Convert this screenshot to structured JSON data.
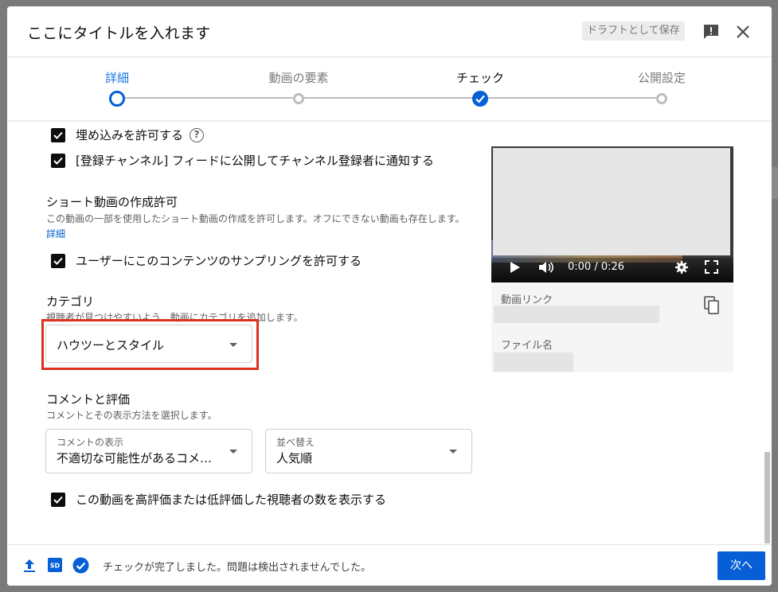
{
  "header": {
    "title": "ここにタイトルを入れます",
    "draft_label": "ドラフトとして保存"
  },
  "steps": [
    {
      "label": "詳細",
      "state": "current"
    },
    {
      "label": "動画の要素",
      "state": "todo"
    },
    {
      "label": "チェック",
      "state": "done"
    },
    {
      "label": "公開設定",
      "state": "todo"
    }
  ],
  "options": {
    "allow_embedding": "埋め込みを許可する",
    "notify_subscribers": "[登録チャンネル] フィードに公開してチャンネル登録者に通知する"
  },
  "shorts": {
    "title": "ショート動画の作成許可",
    "desc": "この動画の一部を使用したショート動画の作成を許可します。オフにできない動画も存在します。",
    "link": "詳細",
    "allow_sampling": "ユーザーにこのコンテンツのサンプリングを許可する"
  },
  "category": {
    "title": "カテゴリ",
    "desc": "視聴者が見つけやすいよう、動画にカテゴリを追加します。",
    "value": "ハウツーとスタイル"
  },
  "comments": {
    "title": "コメントと評価",
    "desc": "コメントとその表示方法を選択します。",
    "display_caption": "コメントの表示",
    "display_value": "不適切な可能性があるコメ…",
    "sort_caption": "並べ替え",
    "sort_value": "人気順",
    "show_ratings": "この動画を高評価または低評価した視聴者の数を表示する"
  },
  "preview": {
    "time": "0:00 / 0:26",
    "video_link_label": "動画リンク",
    "filename_label": "ファイル名"
  },
  "footer": {
    "status": "チェックが完了しました。問題は検出されませんでした。",
    "next_label": "次へ",
    "sd_badge": "SD"
  },
  "colors": {
    "accent": "#065fd4",
    "highlight": "#d9321f"
  }
}
